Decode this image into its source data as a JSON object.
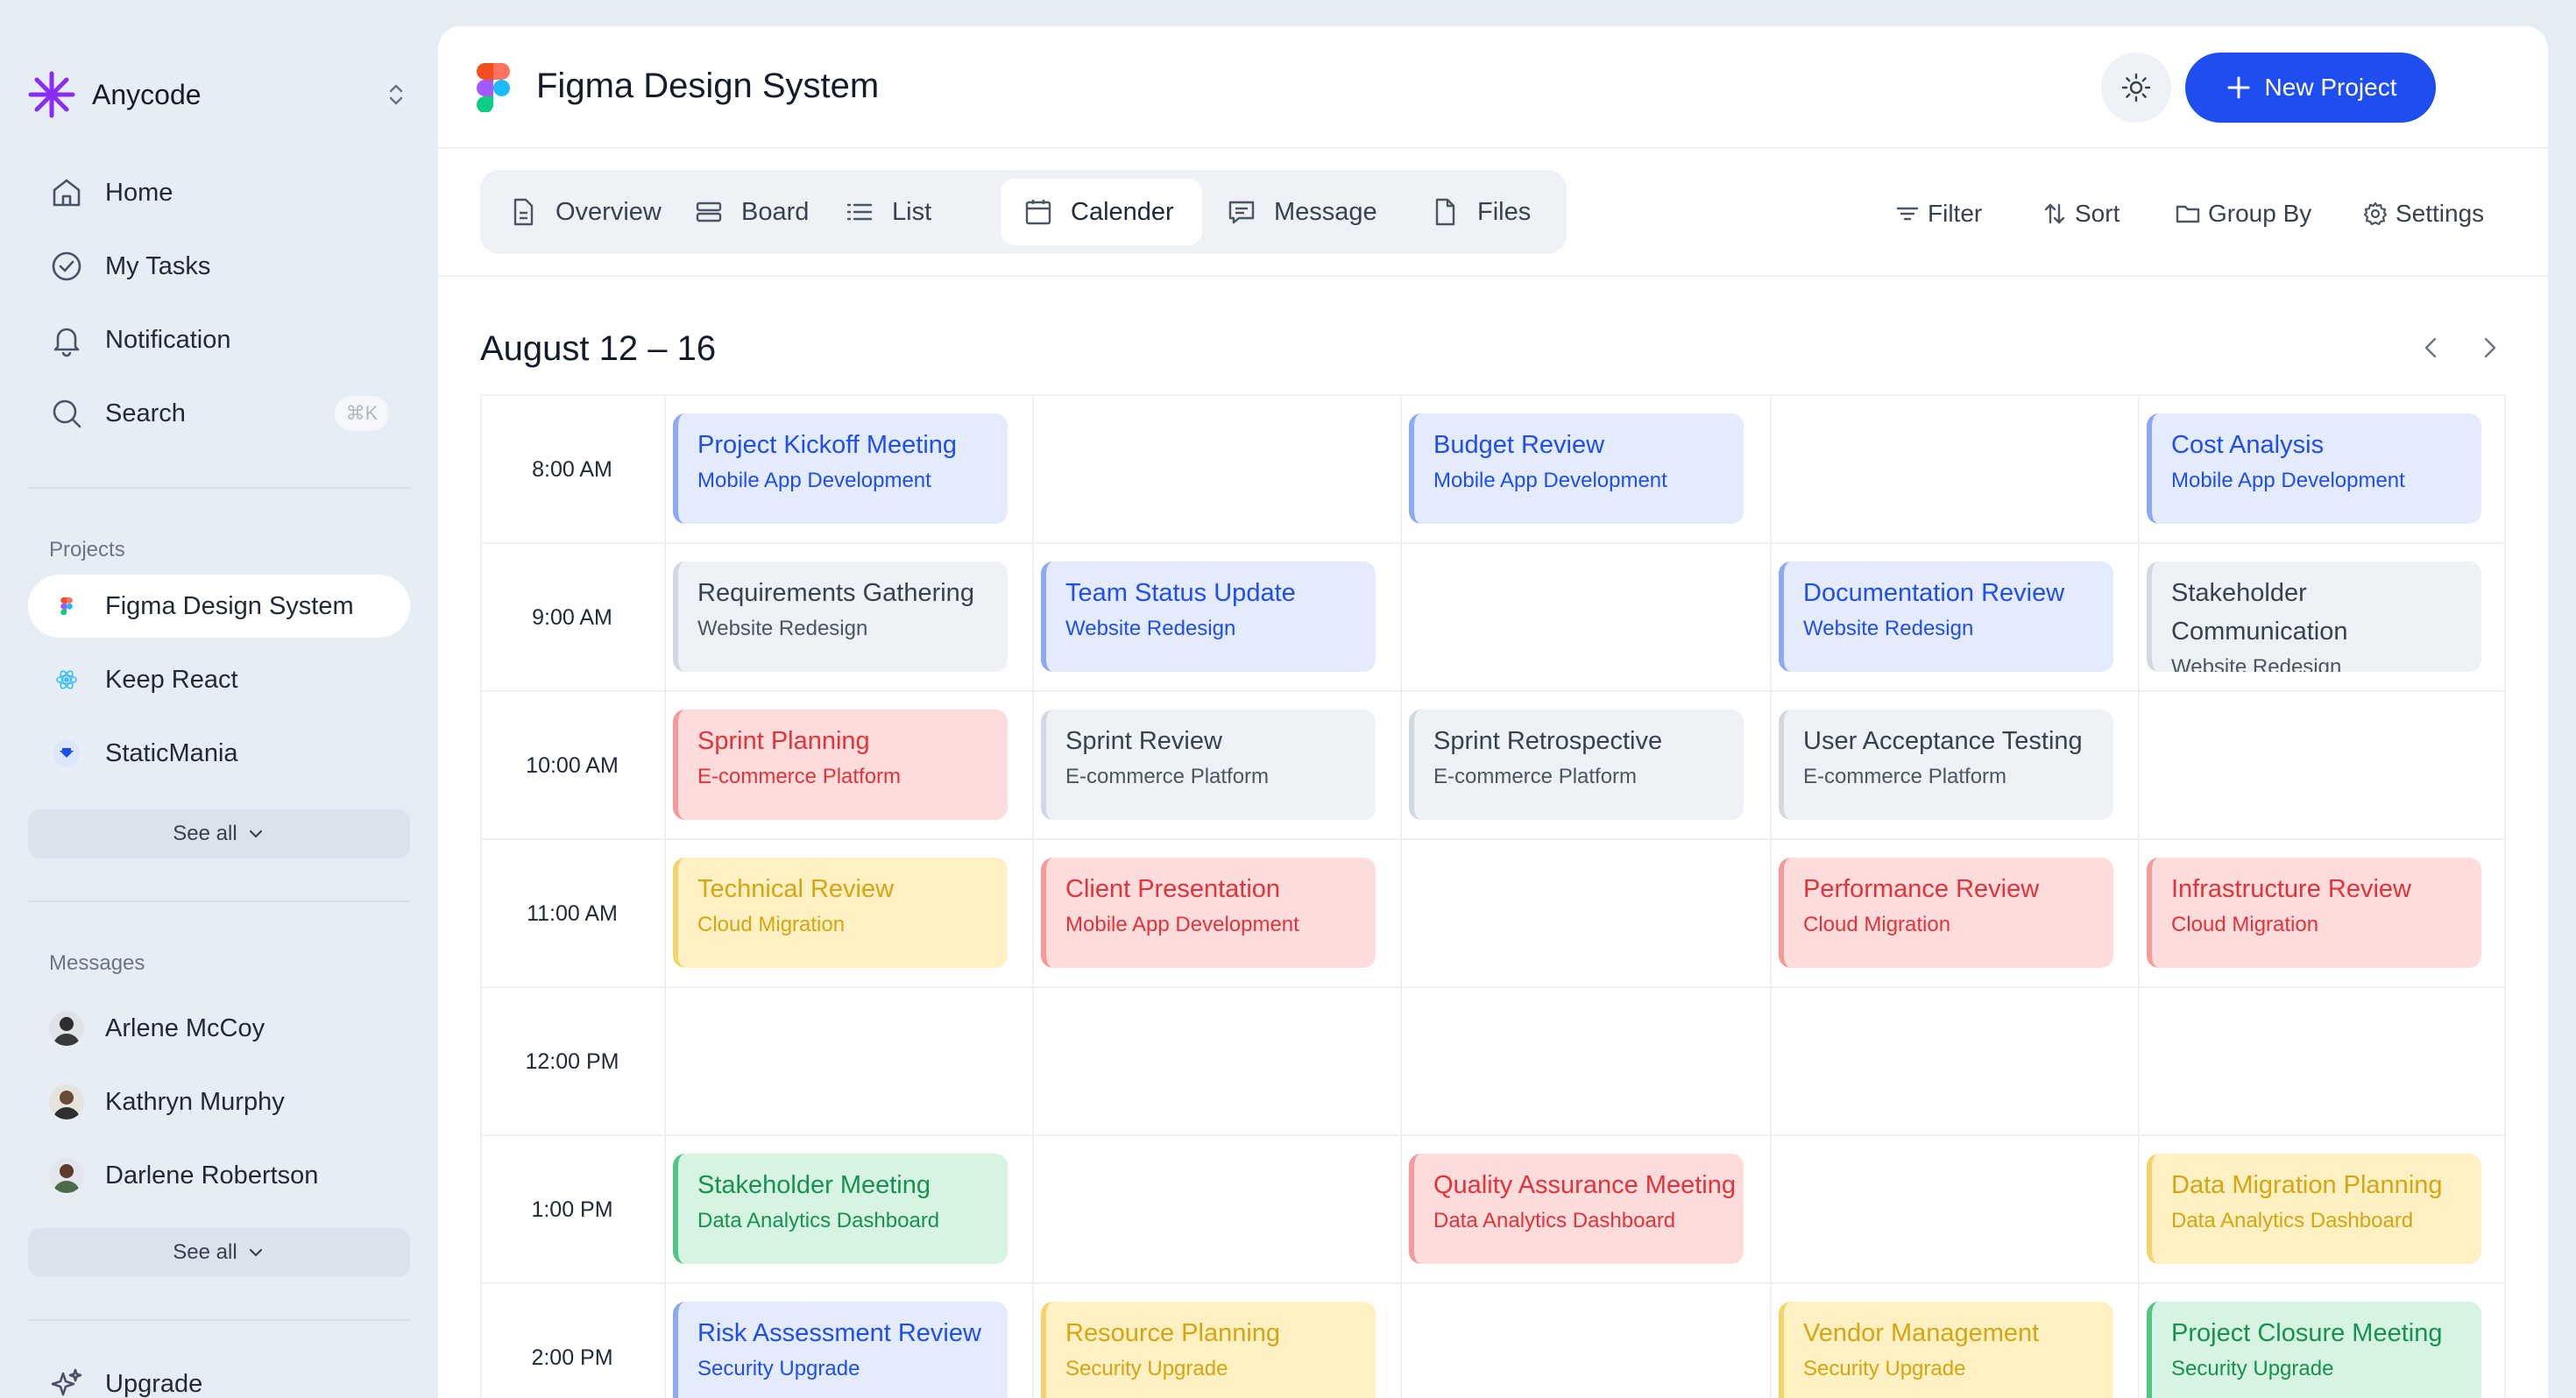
{
  "sidebar": {
    "brand": "Anycode",
    "nav": [
      {
        "label": "Home",
        "icon": "home-icon"
      },
      {
        "label": "My Tasks",
        "icon": "check-circle-icon"
      },
      {
        "label": "Notification",
        "icon": "bell-icon"
      },
      {
        "label": "Search",
        "icon": "search-icon",
        "shortcut": "⌘K"
      }
    ],
    "projects_title": "Projects",
    "projects": [
      {
        "label": "Figma Design System",
        "icon": "figma-icon",
        "active": true
      },
      {
        "label": "Keep React",
        "icon": "react-icon",
        "active": false
      },
      {
        "label": "StaticMania",
        "icon": "staticmania-icon",
        "active": false
      }
    ],
    "projects_see_all": "See all",
    "messages_title": "Messages",
    "messages": [
      {
        "label": "Arlene McCoy"
      },
      {
        "label": "Kathryn Murphy"
      },
      {
        "label": "Darlene Robertson"
      }
    ],
    "messages_see_all": "See all",
    "upgrade": "Upgrade"
  },
  "header": {
    "title": "Figma Design System",
    "new_project": "New Project"
  },
  "tabs": [
    {
      "label": "Overview",
      "icon": "document-icon"
    },
    {
      "label": "Board",
      "icon": "board-icon"
    },
    {
      "label": "List",
      "icon": "list-icon"
    },
    {
      "label": "Calender",
      "icon": "calendar-icon",
      "active": true
    },
    {
      "label": "Message",
      "icon": "message-icon"
    },
    {
      "label": "Files",
      "icon": "file-icon"
    }
  ],
  "tools": [
    {
      "label": "Filter",
      "icon": "filter-icon"
    },
    {
      "label": "Sort",
      "icon": "sort-icon"
    },
    {
      "label": "Group By",
      "icon": "folder-icon"
    },
    {
      "label": "Settings",
      "icon": "gear-icon"
    }
  ],
  "calendar": {
    "range": "August 12 – 16",
    "colors": {
      "blue": "#1f4ef0",
      "gray": "#374151",
      "red": "#e5323a",
      "yellow": "#d7a50f",
      "green": "#15924f"
    },
    "rows": [
      {
        "time": "8:00 AM",
        "events": [
          {
            "day": 0,
            "title": "Project Kickoff Meeting",
            "project": "Mobile App Development",
            "color": "blue"
          },
          {
            "day": 2,
            "title": "Budget Review",
            "project": "Mobile App Development",
            "color": "blue"
          },
          {
            "day": 4,
            "title": "Cost Analysis",
            "project": "Mobile App Development",
            "color": "blue"
          }
        ]
      },
      {
        "time": "9:00 AM",
        "events": [
          {
            "day": 0,
            "title": "Requirements Gathering",
            "project": "Website Redesign",
            "color": "gray"
          },
          {
            "day": 1,
            "title": "Team Status Update",
            "project": "Website Redesign",
            "color": "blue"
          },
          {
            "day": 3,
            "title": "Documentation Review",
            "project": "Website Redesign",
            "color": "blue"
          },
          {
            "day": 4,
            "title": "Stakeholder Communication",
            "project": "Website Redesign",
            "color": "gray"
          }
        ]
      },
      {
        "time": "10:00 AM",
        "events": [
          {
            "day": 0,
            "title": "Sprint Planning",
            "project": "E-commerce Platform",
            "color": "red"
          },
          {
            "day": 1,
            "title": "Sprint Review",
            "project": "E-commerce Platform",
            "color": "gray"
          },
          {
            "day": 2,
            "title": "Sprint Retrospective",
            "project": "E-commerce Platform",
            "color": "gray"
          },
          {
            "day": 3,
            "title": "User Acceptance Testing",
            "project": "E-commerce Platform",
            "color": "gray"
          }
        ]
      },
      {
        "time": "11:00 AM",
        "events": [
          {
            "day": 0,
            "title": "Technical Review",
            "project": "Cloud Migration",
            "color": "yellow"
          },
          {
            "day": 1,
            "title": "Client Presentation",
            "project": "Mobile App Development",
            "color": "red"
          },
          {
            "day": 3,
            "title": "Performance Review",
            "project": "Cloud Migration",
            "color": "red"
          },
          {
            "day": 4,
            "title": "Infrastructure Review",
            "project": "Cloud Migration",
            "color": "red"
          }
        ]
      },
      {
        "time": "12:00 PM",
        "events": []
      },
      {
        "time": "1:00 PM",
        "events": [
          {
            "day": 0,
            "title": "Stakeholder Meeting",
            "project": "Data Analytics Dashboard",
            "color": "green"
          },
          {
            "day": 2,
            "title": "Quality Assurance Meeting",
            "project": "Data Analytics Dashboard",
            "color": "red"
          },
          {
            "day": 4,
            "title": "Data Migration Planning",
            "project": "Data Analytics Dashboard",
            "color": "yellow"
          }
        ]
      },
      {
        "time": "2:00 PM",
        "events": [
          {
            "day": 0,
            "title": "Risk Assessment Review",
            "project": "Security Upgrade",
            "color": "blue"
          },
          {
            "day": 1,
            "title": "Resource Planning",
            "project": "Security Upgrade",
            "color": "yellow"
          },
          {
            "day": 3,
            "title": "Vendor Management",
            "project": "Security Upgrade",
            "color": "yellow"
          },
          {
            "day": 4,
            "title": "Project Closure Meeting",
            "project": "Security Upgrade",
            "color": "green"
          }
        ]
      }
    ]
  }
}
